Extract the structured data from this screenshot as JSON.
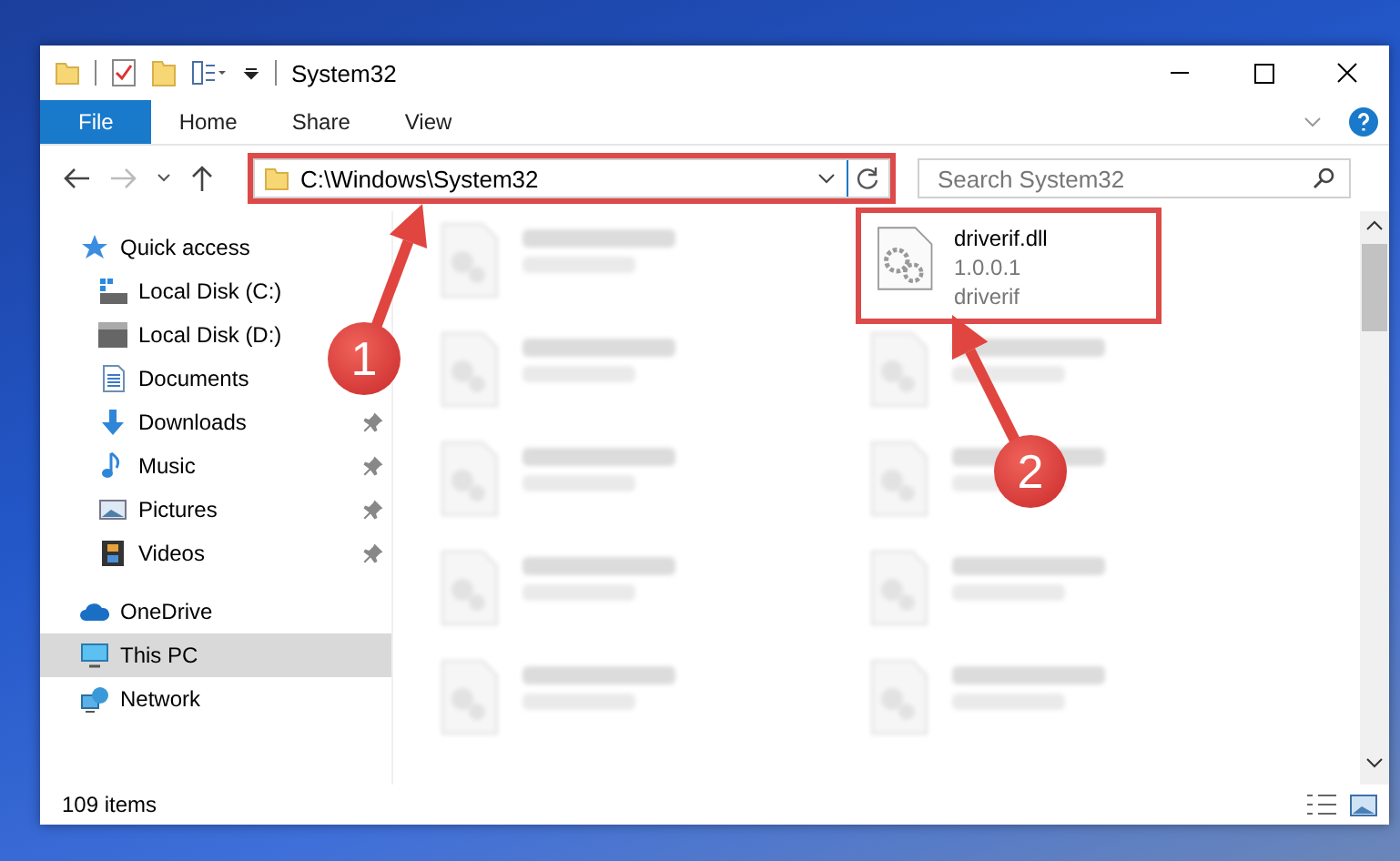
{
  "window": {
    "title": "System32"
  },
  "ribbon_tabs": [
    {
      "label": "File",
      "selected": true
    },
    {
      "label": "Home",
      "selected": false
    },
    {
      "label": "Share",
      "selected": false
    },
    {
      "label": "View",
      "selected": false
    }
  ],
  "address": {
    "path": "C:\\Windows\\System32",
    "highlighted": true
  },
  "search": {
    "placeholder": "Search System32"
  },
  "sidebar": {
    "items": [
      {
        "label": "Quick access",
        "selected": false,
        "children": [
          {
            "label": "Local Disk (C:)",
            "pinned": false,
            "selected": false
          },
          {
            "label": "Local Disk (D:)",
            "pinned": false,
            "selected": false
          },
          {
            "label": "Documents",
            "pinned": false,
            "selected": false
          },
          {
            "label": "Downloads",
            "pinned": true,
            "selected": false
          },
          {
            "label": "Music",
            "pinned": true,
            "selected": false
          },
          {
            "label": "Pictures",
            "pinned": true,
            "selected": false
          },
          {
            "label": "Videos",
            "pinned": true,
            "selected": false
          }
        ]
      },
      {
        "label": "OneDrive",
        "selected": false
      },
      {
        "label": "This PC",
        "selected": true
      },
      {
        "label": "Network",
        "selected": false
      }
    ]
  },
  "files": [
    {
      "kind": "blurred"
    },
    {
      "kind": "file",
      "lines": [
        "driverif.dll",
        "1.0.0.1",
        "driverif"
      ],
      "highlighted": true
    },
    {
      "kind": "blurred"
    },
    {
      "kind": "blurred"
    },
    {
      "kind": "blurred"
    },
    {
      "kind": "blurred"
    },
    {
      "kind": "blurred"
    },
    {
      "kind": "blurred"
    },
    {
      "kind": "blurred"
    },
    {
      "kind": "blurred"
    }
  ],
  "status_bar": {
    "count": "109 items"
  },
  "annotations": [
    {
      "number": "1"
    },
    {
      "number": "2"
    }
  ]
}
